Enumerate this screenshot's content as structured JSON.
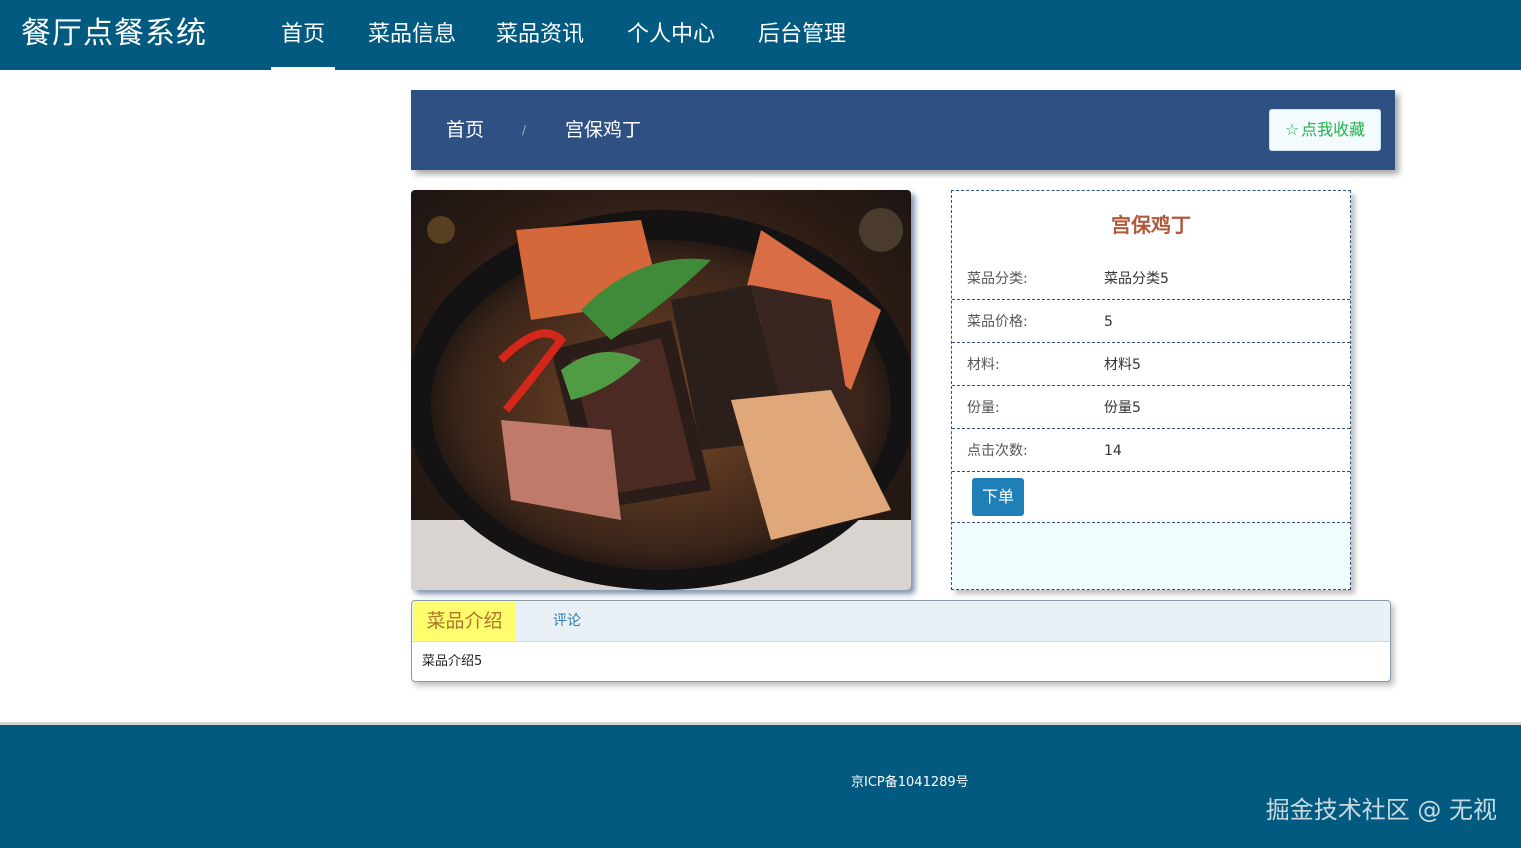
{
  "header": {
    "brand": "餐厅点餐系统",
    "nav": [
      {
        "label": "首页",
        "active": true
      },
      {
        "label": "菜品信息"
      },
      {
        "label": "菜品资讯"
      },
      {
        "label": "个人中心"
      },
      {
        "label": "后台管理"
      }
    ]
  },
  "breadcrumb": {
    "home": "首页",
    "separator": "/",
    "current": "宫保鸡丁",
    "favorite_label": "点我收藏",
    "favorite_icon": "star-outline-icon"
  },
  "detail": {
    "title": "宫保鸡丁",
    "fields": [
      {
        "label": "菜品分类:",
        "value": "菜品分类5"
      },
      {
        "label": "菜品价格:",
        "value": "5"
      },
      {
        "label": "材料:",
        "value": "材料5"
      },
      {
        "label": "份量:",
        "value": "份量5"
      },
      {
        "label": "点击次数:",
        "value": "14"
      }
    ],
    "order_label": "下单"
  },
  "tabs": {
    "active": "菜品介绍",
    "other": "评论",
    "content": "菜品介绍5"
  },
  "footer": {
    "icp": "京ICP备1041289号",
    "watermark": "掘金技术社区 @ 无视"
  },
  "colors": {
    "nav_bg": "#025a80",
    "breadcrumb_bg": "#2f5083",
    "favorite_text": "#21b24a",
    "title": "#b05a3c",
    "order_button": "#1f80b8",
    "tab_active_bg": "#fdfd6e"
  }
}
